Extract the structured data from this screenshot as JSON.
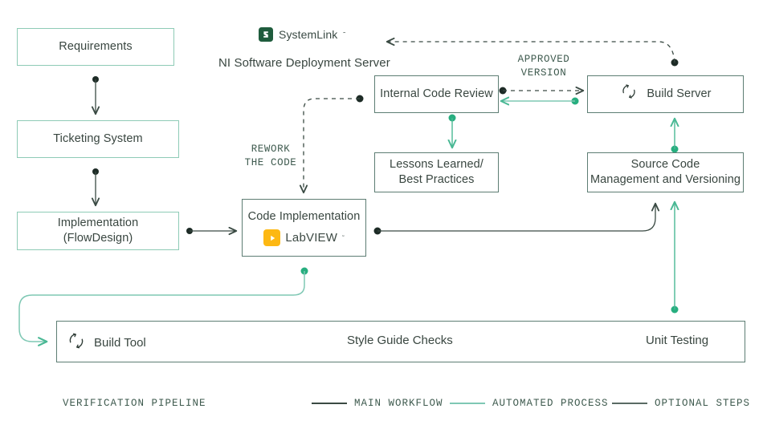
{
  "colors": {
    "mint_border": "#8ecbb6",
    "dark_border": "#5d7d73",
    "green_accent": "#22a06b",
    "green_line": "#7fc8b4",
    "dark_line": "#3a4a43",
    "text": "#394640",
    "systemlink_logo_bg": "#1f5c3d",
    "labview_logo_bg": "#fdb813"
  },
  "header": {
    "systemlink_label": "SystemLink",
    "systemlink_tm": "˜",
    "systemlink_icon": "systemlink-logo-icon",
    "ni_caption": "NI Software Deployment Server"
  },
  "nodes": {
    "requirements": {
      "label": "Requirements",
      "style": "light"
    },
    "ticketing_system": {
      "label": "Ticketing System",
      "style": "light"
    },
    "implementation": {
      "line1": "Implementation",
      "line2": "(FlowDesign)",
      "style": "light"
    },
    "code_implementation": {
      "label": "Code Implementation",
      "style": "dark",
      "badge": {
        "name": "LabVIEW",
        "tm": "˜",
        "icon": "labview-play-icon"
      }
    },
    "internal_code_review": {
      "label": "Internal Code Review",
      "style": "dark"
    },
    "lessons_learned": {
      "line1": "Lessons Learned/",
      "line2": "Best Practices",
      "style": "dark"
    },
    "build_server": {
      "label": "Build Server",
      "style": "dark",
      "icon": "cycle-arrows-icon"
    },
    "source_code": {
      "line1": "Source Code",
      "line2": "Management and Versioning",
      "style": "dark"
    }
  },
  "edge_labels": {
    "rework": {
      "line1": "REWORK",
      "line2": "THE CODE"
    },
    "approved": {
      "line1": "APPROVED",
      "line2": "VERSION"
    }
  },
  "pipeline": {
    "items": [
      {
        "label": "Build Tool",
        "icon": "cycle-arrows-icon"
      },
      {
        "label": "Style Guide Checks",
        "icon": ""
      },
      {
        "label": "Unit Testing",
        "icon": ""
      }
    ]
  },
  "legend": {
    "title": "VERIFICATION PIPELINE",
    "entries": [
      {
        "label": "MAIN WORKFLOW",
        "color": "#3a4a43"
      },
      {
        "label": "AUTOMATED PROCESS",
        "color": "#7fc8b4"
      },
      {
        "label": "OPTIONAL STEPS",
        "color": "#5a6a64"
      }
    ]
  }
}
